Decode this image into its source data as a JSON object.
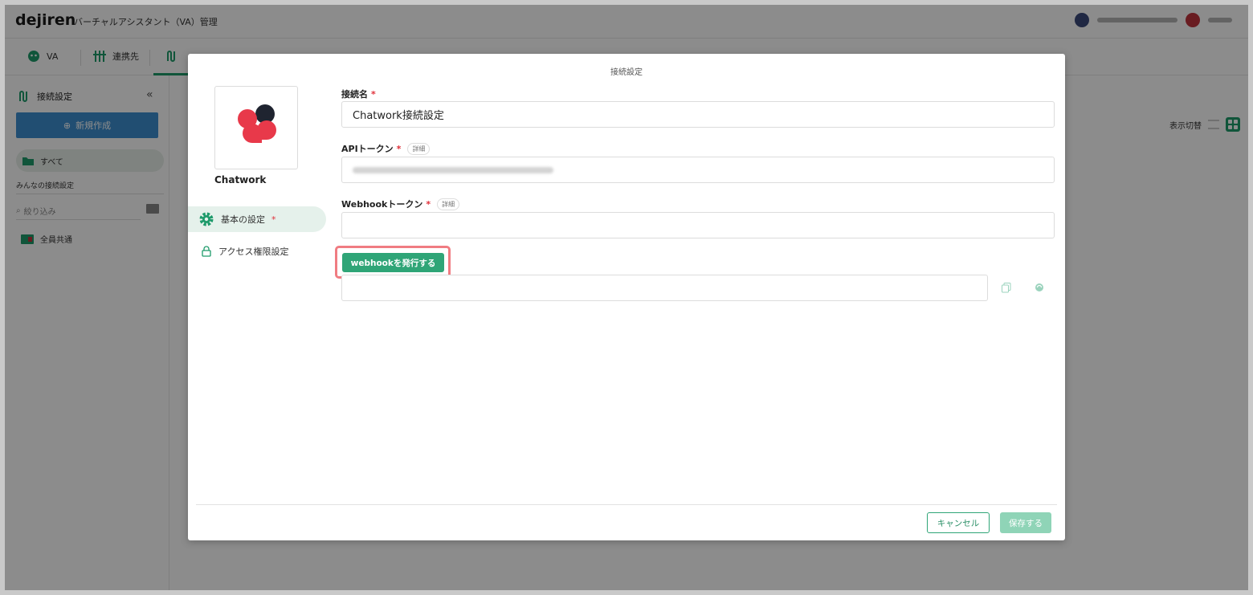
{
  "app": {
    "brand": "dejiren",
    "title": "バーチャルアシスタント（VA）管理"
  },
  "nav": {
    "va": "VA",
    "connections": "連携先"
  },
  "sidebar": {
    "heading": "接続設定",
    "new_button": "新規作成",
    "all": "すべて",
    "section": "みんなの接続設定",
    "filter_placeholder": "絞り込み",
    "shared": "全員共通"
  },
  "view_toggle": {
    "label": "表示切替"
  },
  "modal": {
    "title": "接続設定",
    "service_name": "Chatwork",
    "menu": [
      {
        "label": "基本の設定",
        "required": "*"
      },
      {
        "label": "アクセス権限設定"
      }
    ],
    "fields": {
      "connection_name": {
        "label": "接続名",
        "required": "*",
        "value": "Chatwork接続設定"
      },
      "api_token": {
        "label": "APIトークン",
        "required": "*",
        "detail": "詳細"
      },
      "webhook_token": {
        "label": "Webhookトークン",
        "required": "*",
        "detail": "詳細",
        "value": ""
      }
    },
    "webhook_button": "webhookを発行する",
    "cancel": "キャンセル",
    "save": "保存する"
  },
  "colors": {
    "accent": "#2fa577",
    "highlight": "#f07c82",
    "required": "#e0303a",
    "chatwork_red": "#e8394a",
    "chatwork_dark": "#1f2430"
  }
}
